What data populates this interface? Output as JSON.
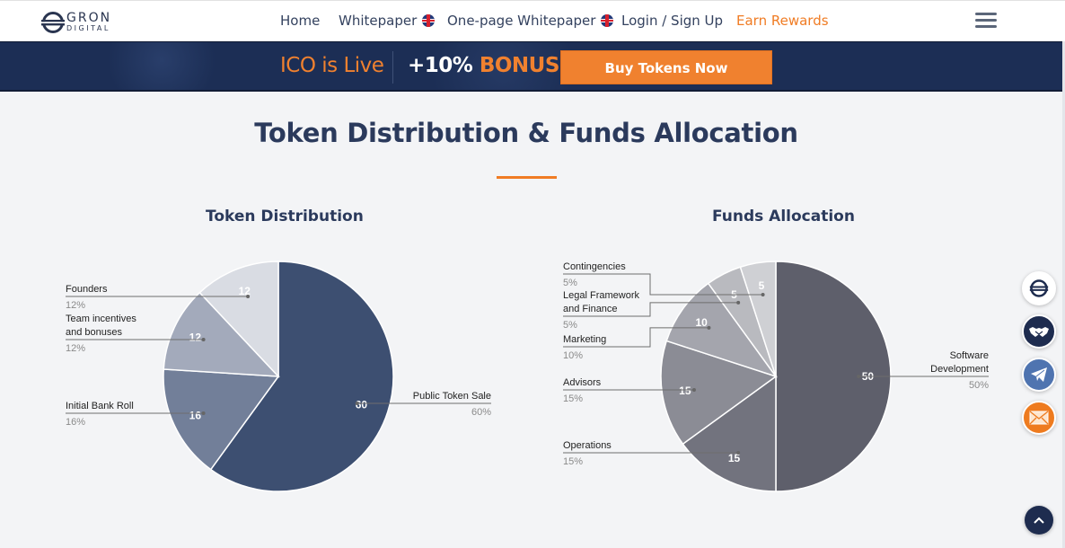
{
  "header": {
    "logo": {
      "line1": "GRON",
      "line2": "DIGITAL"
    },
    "nav": [
      {
        "label": "Home",
        "flag": false,
        "highlight": false
      },
      {
        "label": "Whitepaper",
        "flag": true,
        "highlight": false
      },
      {
        "label": "One-page Whitepaper",
        "flag": true,
        "highlight": false
      },
      {
        "label": "Login / Sign Up",
        "flag": false,
        "highlight": false
      },
      {
        "label": "Earn Rewards",
        "flag": false,
        "highlight": true
      }
    ],
    "menu_icon": "hamburger-icon"
  },
  "banner": {
    "status": "ICO is Live",
    "bonus_amount": "+10%",
    "bonus_word": "BONUS",
    "cta": "Buy Tokens Now"
  },
  "section": {
    "title": "Token Distribution & Funds Allocation"
  },
  "colors": {
    "accent_orange": "#f07c24",
    "navy": "#1c2e55",
    "title_navy": "#2b3a5c"
  },
  "side_icons": [
    {
      "name": "gron-logo-icon",
      "bg": "#ffffff"
    },
    {
      "name": "handshake-icon",
      "bg": "#1e2c4f"
    },
    {
      "name": "telegram-icon",
      "bg": "#4f74b0"
    },
    {
      "name": "email-icon",
      "bg": "#ee7b1f"
    }
  ],
  "scroll_top_icon": "chevron-up-icon",
  "chart_data": [
    {
      "type": "pie",
      "title": "Token Distribution",
      "categories": [
        "Public Token Sale",
        "Initial Bank Roll",
        "Team incentives and bonuses",
        "Founders"
      ],
      "values": [
        60,
        16,
        12,
        12
      ],
      "percent_labels": [
        "60%",
        "16%",
        "12%",
        "12%"
      ],
      "colors": [
        "#3d4f71",
        "#727f99",
        "#a3aabb",
        "#d9dce3"
      ],
      "start": "12 o'clock",
      "direction": "clockwise"
    },
    {
      "type": "pie",
      "title": "Funds Allocation",
      "categories": [
        "Software Development",
        "Operations",
        "Advisors",
        "Marketing",
        "Legal Framework and Finance",
        "Contingencies"
      ],
      "values": [
        50,
        15,
        15,
        10,
        5,
        5
      ],
      "percent_labels": [
        "50%",
        "15%",
        "15%",
        "10%",
        "5%",
        "5%"
      ],
      "colors": [
        "#5e5f6b",
        "#72737e",
        "#8b8c95",
        "#a4a5ad",
        "#b9babf",
        "#cfd0d4"
      ],
      "start": "12 o'clock",
      "direction": "clockwise"
    }
  ]
}
